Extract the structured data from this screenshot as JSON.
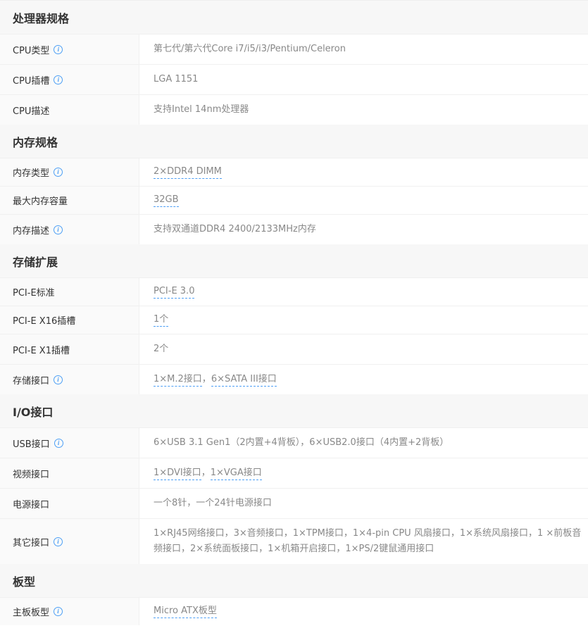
{
  "sections": [
    {
      "title": "处理器规格",
      "rows": [
        {
          "label": "CPU类型",
          "info": true,
          "parts": [
            {
              "text": "第七代/第六代Core i7/i5/i3/Pentium/Celeron",
              "link": false
            }
          ]
        },
        {
          "label": "CPU插槽",
          "info": true,
          "parts": [
            {
              "text": "LGA 1151",
              "link": false
            }
          ]
        },
        {
          "label": "CPU描述",
          "info": false,
          "parts": [
            {
              "text": "支持Intel 14nm处理器",
              "link": false
            }
          ]
        }
      ]
    },
    {
      "title": "内存规格",
      "rows": [
        {
          "label": "内存类型",
          "info": true,
          "parts": [
            {
              "text": "2×DDR4 DIMM",
              "link": true
            }
          ]
        },
        {
          "label": "最大内存容量",
          "info": false,
          "parts": [
            {
              "text": "32GB",
              "link": true
            }
          ]
        },
        {
          "label": "内存描述",
          "info": true,
          "parts": [
            {
              "text": "支持双通道DDR4 2400/2133MHz内存",
              "link": false
            }
          ]
        }
      ]
    },
    {
      "title": "存储扩展",
      "rows": [
        {
          "label": "PCI-E标准",
          "info": false,
          "parts": [
            {
              "text": "PCI-E 3.0",
              "link": true
            }
          ]
        },
        {
          "label": "PCI-E X16插槽",
          "info": false,
          "parts": [
            {
              "text": "1个",
              "link": true
            }
          ]
        },
        {
          "label": "PCI-E X1插槽",
          "info": false,
          "parts": [
            {
              "text": "2个",
              "link": false
            }
          ]
        },
        {
          "label": "存储接口",
          "info": true,
          "parts": [
            {
              "text": "1×M.2接口",
              "link": true
            },
            {
              "text": "，",
              "link": false
            },
            {
              "text": "6×SATA III接口",
              "link": true
            }
          ]
        }
      ]
    },
    {
      "title": "I/O接口",
      "rows": [
        {
          "label": "USB接口",
          "info": true,
          "parts": [
            {
              "text": "6×USB 3.1 Gen1（2内置+4背板），6×USB2.0接口（4内置+2背板）",
              "link": false
            }
          ]
        },
        {
          "label": "视频接口",
          "info": false,
          "parts": [
            {
              "text": "1×DVI接口",
              "link": true
            },
            {
              "text": "，",
              "link": false
            },
            {
              "text": "1×VGA接口",
              "link": true
            }
          ]
        },
        {
          "label": "电源接口",
          "info": false,
          "parts": [
            {
              "text": "一个8针，一个24针电源接口",
              "link": false
            }
          ]
        },
        {
          "label": "其它接口",
          "info": true,
          "multi": true,
          "parts": [
            {
              "text": "1×RJ45网络接口，3×音频接口，1×TPM接口，1×4-pin CPU 风扇接口，1×系统风扇接口，1 ×前板音频接口，2×系统面板接口，1×机箱开启接口，1×PS/2键鼠通用接口",
              "link": false
            }
          ]
        }
      ]
    },
    {
      "title": "板型",
      "rows": [
        {
          "label": "主板板型",
          "info": true,
          "parts": [
            {
              "text": "Micro ATX板型",
              "link": true
            }
          ]
        }
      ]
    }
  ]
}
